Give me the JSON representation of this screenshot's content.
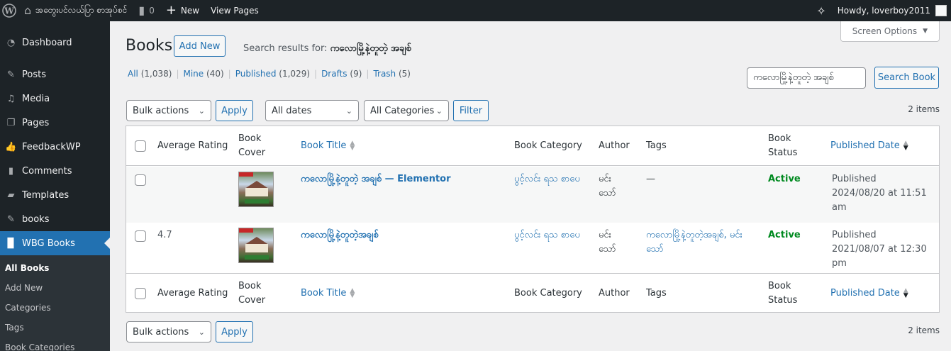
{
  "adminbar": {
    "site_name": "အတွေးပင်လယ်ပြာ စာအုပ်စင်",
    "comments_count": "0",
    "new_label": "New",
    "view_pages_label": "View Pages",
    "howdy": "Howdy, loverboy2011"
  },
  "sidebar": {
    "items": [
      {
        "label": "Dashboard",
        "icon": "dashboard-icon"
      },
      {
        "label": "Posts",
        "icon": "pin-icon"
      },
      {
        "label": "Media",
        "icon": "media-icon"
      },
      {
        "label": "Pages",
        "icon": "pages-icon"
      },
      {
        "label": "FeedbackWP",
        "icon": "thumbs-up-icon"
      },
      {
        "label": "Comments",
        "icon": "comment-icon"
      },
      {
        "label": "Templates",
        "icon": "folder-icon"
      },
      {
        "label": "books",
        "icon": "pin-icon"
      },
      {
        "label": "WBG Books",
        "icon": "book-icon"
      }
    ],
    "submenu": [
      "All Books",
      "Add New",
      "Categories",
      "Tags",
      "Book Categories"
    ]
  },
  "main": {
    "screen_options": "Screen Options",
    "title": "Books",
    "add_new": "Add New",
    "search_results_prefix": "Search results for:",
    "search_term": "ကလောမြို့နဲ့တူတဲ့ အချစ်",
    "views": [
      {
        "label": "All",
        "count": "(1,038)"
      },
      {
        "label": "Mine",
        "count": "(40)"
      },
      {
        "label": "Published",
        "count": "(1,029)"
      },
      {
        "label": "Drafts",
        "count": "(9)"
      },
      {
        "label": "Trash",
        "count": "(5)"
      }
    ],
    "search_input_value": "ကလောမြို့နဲ့တူတဲ့ အချစ်",
    "search_button": "Search Book",
    "bulk_actions": "Bulk actions",
    "apply": "Apply",
    "all_dates": "All dates",
    "all_categories": "All Categories",
    "filter": "Filter",
    "items_count": "2 items"
  },
  "table": {
    "columns": {
      "rating": "Average Rating",
      "cover": "Book Cover",
      "title": "Book Title",
      "category": "Book Category",
      "author": "Author",
      "tags": "Tags",
      "status": "Book Status",
      "date": "Published Date"
    },
    "rows": [
      {
        "rating": "",
        "title": "ကလောမြို့နဲ့တူတဲ့ အချစ်",
        "title_suffix": " — Elementor",
        "category": "ပွင့်လင်း ရသ စာပေ",
        "author": "မင်းသော်",
        "tags": "—",
        "status": "Active",
        "date_status": "Published",
        "date": "2024/08/20 at 11:51 am"
      },
      {
        "rating": "4.7",
        "title": "ကလောမြို့နဲ့တူတဲ့အချစ်",
        "title_suffix": "",
        "category": "ပွင့်လင်း ရသ စာပေ",
        "author": "မင်းသော်",
        "tags": "ကလောမြို့နဲ့တူတဲ့အချစ်, မင်းသော်",
        "status": "Active",
        "date_status": "Published",
        "date": "2021/08/07 at 12:30 pm"
      }
    ]
  }
}
